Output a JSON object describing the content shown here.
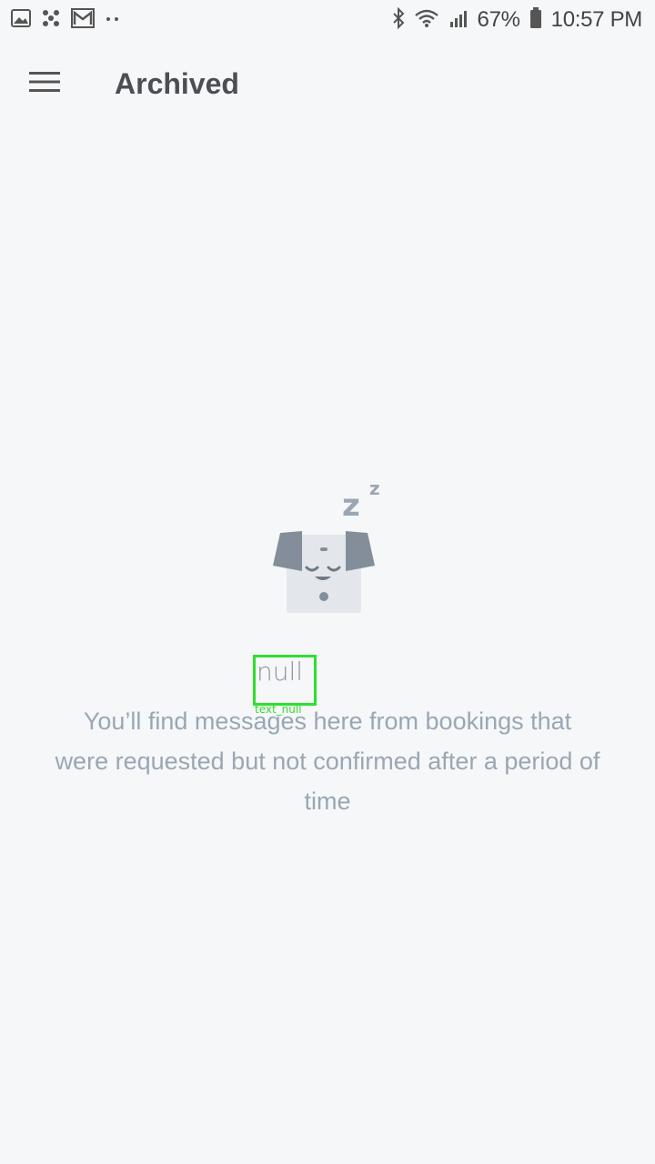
{
  "status_bar": {
    "battery": "67%",
    "time": "10:57 PM",
    "left_icons": [
      "image-icon",
      "pinwheel-icon",
      "gmail-icon",
      "more-dots-icon"
    ],
    "right_icons": [
      "bluetooth-icon",
      "wifi-icon",
      "signal-icon",
      "battery-icon"
    ]
  },
  "app_bar": {
    "title": "Archived",
    "menu_icon": "hamburger-menu-icon"
  },
  "empty_state": {
    "illustration": "sleeping-dog-icon",
    "debug_text": "null",
    "debug_label": "text_null",
    "message": "You’ll find messages here from bookings that were requested but not confirmed after a period of time"
  },
  "colors": {
    "background": "#f6f7f9",
    "title": "#4b4f55",
    "message": "#9aa7b3",
    "debug_outline": "#2ee02e"
  }
}
